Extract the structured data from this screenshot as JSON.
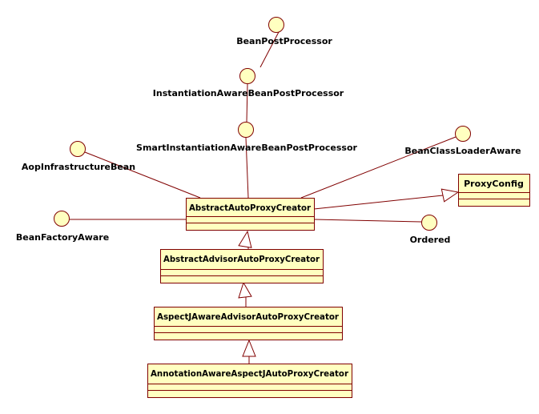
{
  "colors": {
    "stroke": "#800000",
    "fill": "#FFFFC0",
    "text": "#000000",
    "background": "#FFFFFF"
  },
  "interfaces": [
    {
      "id": "bpp",
      "name": "BeanPostProcessor"
    },
    {
      "id": "iabpp",
      "name": "InstantiationAwareBeanPostProcessor"
    },
    {
      "id": "siabpp",
      "name": "SmartInstantiationAwareBeanPostProcessor"
    },
    {
      "id": "aib",
      "name": "AopInfrastructureBean"
    },
    {
      "id": "bfa",
      "name": "BeanFactoryAware"
    },
    {
      "id": "bcla",
      "name": "BeanClassLoaderAware"
    },
    {
      "id": "ord",
      "name": "Ordered"
    }
  ],
  "classes": [
    {
      "id": "aapc",
      "name": "AbstractAutoProxyCreator"
    },
    {
      "id": "pc",
      "name": "ProxyConfig"
    },
    {
      "id": "aaapc",
      "name": "AbstractAdvisorAutoProxyCreator"
    },
    {
      "id": "ajaapc",
      "name": "AspectJAwareAdvisorAutoProxyCreator"
    },
    {
      "id": "aaajapc",
      "name": "AnnotationAwareAspectJAutoProxyCreator"
    }
  ],
  "relations": [
    {
      "from": "iabpp",
      "to": "bpp",
      "type": "realization"
    },
    {
      "from": "siabpp",
      "to": "iabpp",
      "type": "realization"
    },
    {
      "from": "aapc",
      "to": "siabpp",
      "type": "realization"
    },
    {
      "from": "aapc",
      "to": "aib",
      "type": "realization"
    },
    {
      "from": "aapc",
      "to": "bfa",
      "type": "realization"
    },
    {
      "from": "aapc",
      "to": "bcla",
      "type": "realization"
    },
    {
      "from": "aapc",
      "to": "ord",
      "type": "realization"
    },
    {
      "from": "aapc",
      "to": "pc",
      "type": "generalization"
    },
    {
      "from": "aaapc",
      "to": "aapc",
      "type": "generalization"
    },
    {
      "from": "ajaapc",
      "to": "aaapc",
      "type": "generalization"
    },
    {
      "from": "aaajapc",
      "to": "ajaapc",
      "type": "generalization"
    }
  ]
}
